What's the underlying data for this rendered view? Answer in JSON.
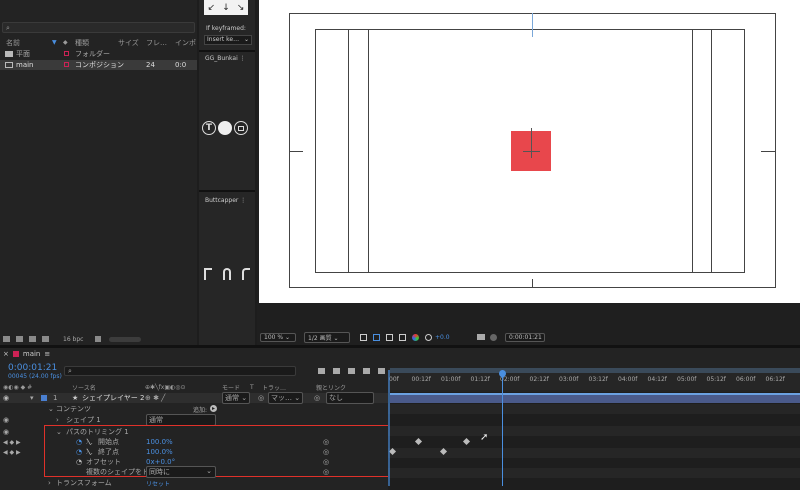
{
  "project": {
    "search_placeholder": "",
    "columns": [
      "名前",
      "種類",
      "サイズ",
      "フレ…",
      "インポ"
    ],
    "items": [
      {
        "name": "平面",
        "type": "フォルダー",
        "size": "",
        "fps": "",
        "in": ""
      },
      {
        "name": "main",
        "type": "コンポジション",
        "size": "",
        "fps": "24",
        "in": "0:0"
      }
    ],
    "bpc": "16 bpc"
  },
  "plugins": {
    "if_keyframed_label": "If keyframed:",
    "insert_value": "Insert ke…",
    "gg_title": "GG_Bunkai",
    "buttcapper_title": "Buttcapper"
  },
  "viewer": {
    "zoom": "100 %",
    "resolution": "1/2 画質",
    "exposure": "+0.0",
    "timecode": "0:00:01:21"
  },
  "timeline": {
    "tab": "main",
    "current_time": "0:00:01:21",
    "frame_info": "00045 (24.00 fps)",
    "search_placeholder": "",
    "col_source": "ソース名",
    "col_mode": "モード",
    "col_t": "T",
    "col_track": "トラッ…",
    "col_parent": "親とリンク",
    "ruler": [
      "00f",
      "00:12f",
      "01:00f",
      "01:12f",
      "02:00f",
      "02:12f",
      "03:00f",
      "03:12f",
      "04:00f",
      "04:12f",
      "05:00f",
      "05:12f",
      "06:00f",
      "06:12f"
    ],
    "layer": {
      "num": "1",
      "name": "シェイプレイヤー 2",
      "mode": "通常",
      "track": "マッ…",
      "parent": "なし"
    },
    "contents": "コンテンツ",
    "add_label": "追加:",
    "shape1": "シェイプ 1",
    "shape1_mode": "通常",
    "trim": "パスのトリミング 1",
    "start_label": "開始点",
    "start_value": "100.0%",
    "end_label": "終了点",
    "end_value": "100.0%",
    "offset_label": "オフセット",
    "offset_value": "0x+0.0°",
    "multi_label": "複数のシェイプをトリム",
    "multi_value": "同時に",
    "transform": "トランスフォーム",
    "reset": "リセット"
  },
  "colors": {
    "accent": "#4a8fe0",
    "highlight": "#e0312a",
    "shape": "#e8474c"
  }
}
